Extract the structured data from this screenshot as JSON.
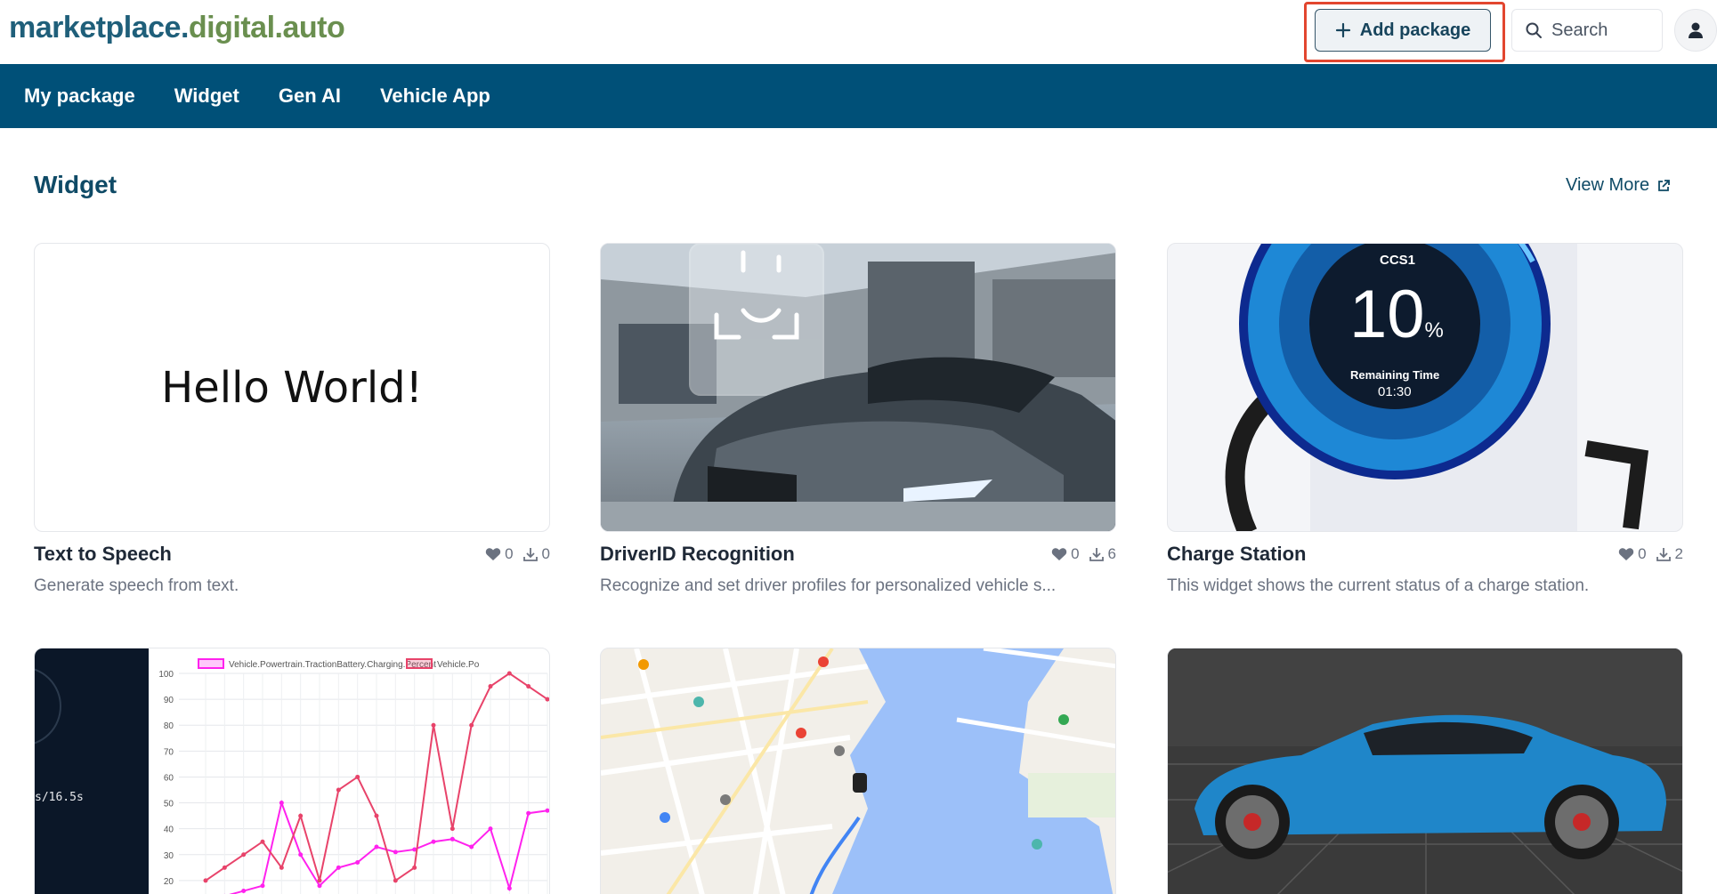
{
  "header": {
    "logo_part1": "marketplace.",
    "logo_part2": "digital.auto",
    "add_package": "Add package",
    "search_placeholder": "Search"
  },
  "nav": {
    "items": [
      {
        "label": "My package"
      },
      {
        "label": "Widget"
      },
      {
        "label": "Gen AI"
      },
      {
        "label": "Vehicle App"
      }
    ]
  },
  "section": {
    "title": "Widget",
    "view_more": "View More"
  },
  "cards": [
    {
      "title": "Text to Speech",
      "likes": "0",
      "downloads": "0",
      "desc": "Generate speech from text.",
      "thumb_text": "Hello World!"
    },
    {
      "title": "DriverID Recognition",
      "likes": "0",
      "downloads": "6",
      "desc": "Recognize and set driver profiles for personalized vehicle s..."
    },
    {
      "title": "Charge Station",
      "likes": "0",
      "downloads": "2",
      "desc": "This widget shows the current status of a charge station.",
      "thumb": {
        "label": "CCS1",
        "percent": "10",
        "unit": "%",
        "remaining_label": "Remaining Time",
        "remaining_value": "01:30"
      }
    },
    {
      "thumb": {
        "time_readout": "s/16.5s",
        "legend1": "Vehicle.Powertrain.TractionBattery.Charging.Percent",
        "legend2": "Vehicle.Po"
      }
    },
    {
      "thumb": {}
    },
    {
      "thumb": {}
    }
  ],
  "chart_data": {
    "type": "line",
    "ylim": [
      20,
      100
    ],
    "yticks": [
      "100",
      "90",
      "80",
      "70",
      "60",
      "50",
      "40",
      "30",
      "20"
    ],
    "series": [
      {
        "name": "Vehicle.Powertrain.TractionBattery.Charging.Percent",
        "color": "#ff22ee",
        "values": [
          12,
          14,
          16,
          18,
          50,
          30,
          18,
          25,
          27,
          33,
          31,
          32,
          35,
          36,
          33,
          40,
          17,
          46,
          47
        ]
      },
      {
        "name": "Vehicle.Po",
        "color": "#e8436a",
        "values": [
          20,
          25,
          30,
          35,
          25,
          45,
          20,
          55,
          60,
          45,
          20,
          25,
          80,
          40,
          80,
          95,
          100,
          95,
          90
        ]
      }
    ]
  },
  "colors": {
    "nav_bg": "#005078",
    "accent": "#0f4a66",
    "highlight": "#e2462f"
  }
}
